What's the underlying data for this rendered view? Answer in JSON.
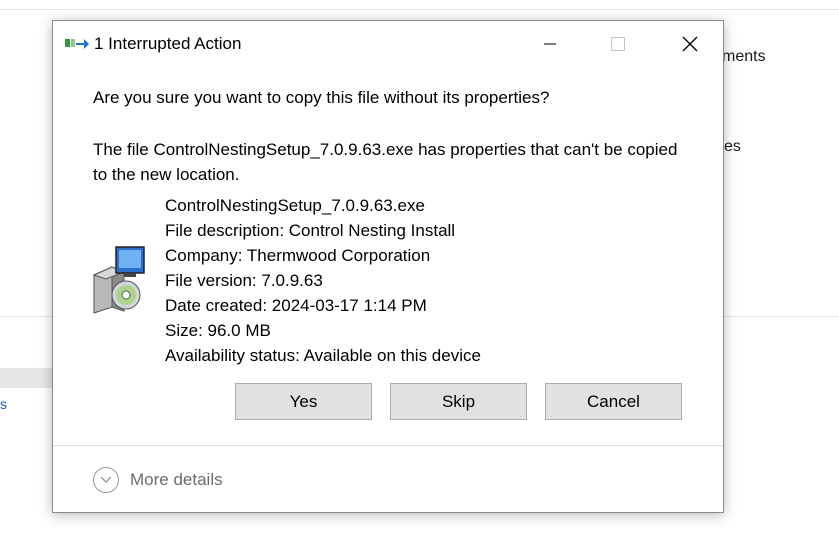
{
  "background": {
    "frag_top": "ments",
    "frag_mid": "es",
    "frag_link": "s"
  },
  "dialog": {
    "title": "1 Interrupted Action",
    "question": "Are you sure you want to copy this file without its properties?",
    "message": "The file ControlNestingSetup_7.0.9.63.exe has properties that can't be copied to the new location.",
    "file": {
      "name": "ControlNestingSetup_7.0.9.63.exe",
      "description": "File description: Control Nesting Install",
      "company": "Company: Thermwood Corporation",
      "version": "File version: 7.0.9.63",
      "date_created": "Date created: 2024-03-17 1:14 PM",
      "size": "Size: 96.0 MB",
      "availability": "Availability status: Available on this device"
    },
    "buttons": {
      "yes": "Yes",
      "skip": "Skip",
      "cancel": "Cancel"
    },
    "more_details": "More details"
  },
  "icons": {
    "title": "copy-action-icon",
    "file": "installer-setup-icon",
    "minimize": "minimize-icon",
    "maximize": "maximize-icon",
    "close": "close-icon",
    "expand": "chevron-down-icon"
  },
  "colors": {
    "button_bg": "#e1e1e1",
    "button_border": "#adadad",
    "muted_text": "#6d6d6d",
    "accent_green": "#2e9e3a",
    "accent_blue": "#1c74d8"
  }
}
